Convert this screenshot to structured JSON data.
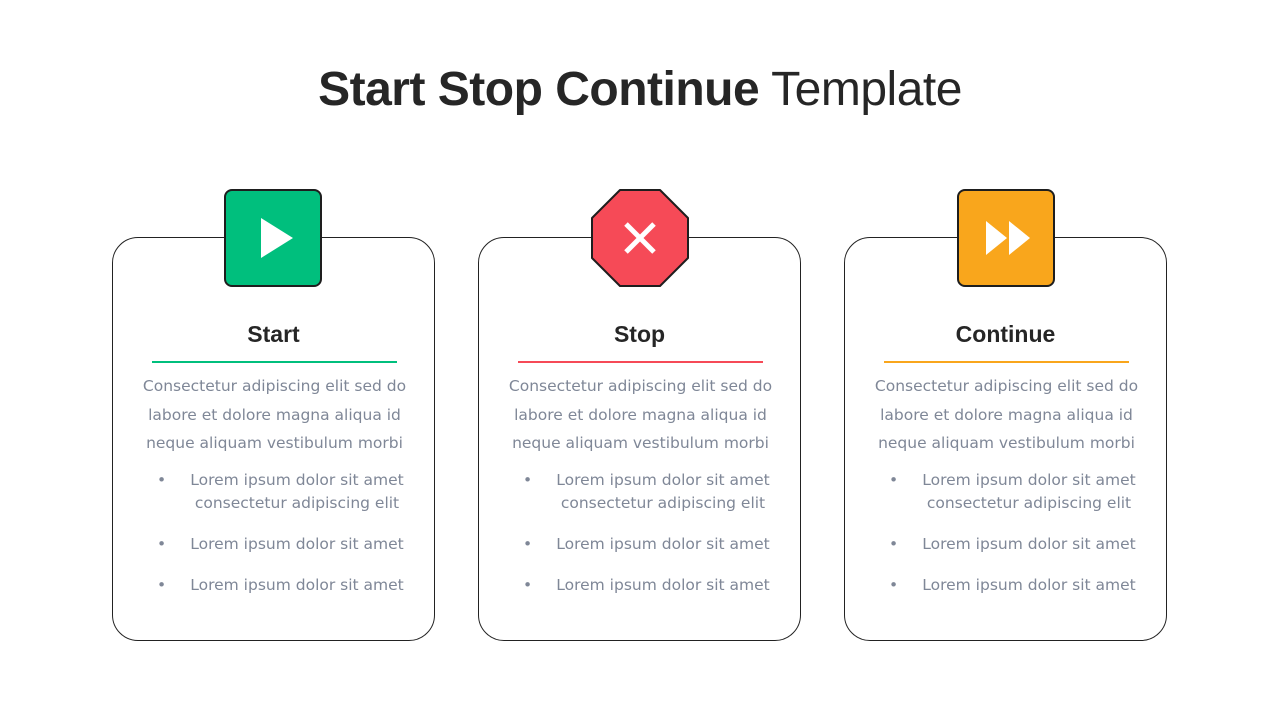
{
  "title": {
    "bold": "Start Stop Continue",
    "light": " Template"
  },
  "cards": [
    {
      "key": "start",
      "heading": "Start",
      "icon": "play-icon",
      "color": "#00bf7d",
      "description": "Consectetur adipiscing elit sed do labore et dolore magna aliqua id neque aliquam vestibulum morbi",
      "bullets": [
        "Lorem ipsum dolor sit amet consectetur adipiscing elit",
        "Lorem ipsum dolor sit amet",
        "Lorem ipsum dolor sit amet"
      ]
    },
    {
      "key": "stop",
      "heading": "Stop",
      "icon": "close-x-icon",
      "color": "#f64a57",
      "description": "Consectetur adipiscing elit sed do labore et dolore magna aliqua id neque aliquam vestibulum morbi",
      "bullets": [
        "Lorem ipsum dolor sit amet consectetur adipiscing elit",
        "Lorem ipsum dolor sit amet",
        "Lorem ipsum dolor sit amet"
      ]
    },
    {
      "key": "continue",
      "heading": "Continue",
      "icon": "fast-forward-icon",
      "color": "#f9a61c",
      "description": "Consectetur adipiscing elit sed do labore et dolore magna aliqua id neque aliquam vestibulum morbi",
      "bullets": [
        "Lorem ipsum dolor sit amet consectetur adipiscing elit",
        "Lorem ipsum dolor sit amet",
        "Lorem ipsum dolor sit amet"
      ]
    }
  ],
  "bullet_glyph": "•"
}
